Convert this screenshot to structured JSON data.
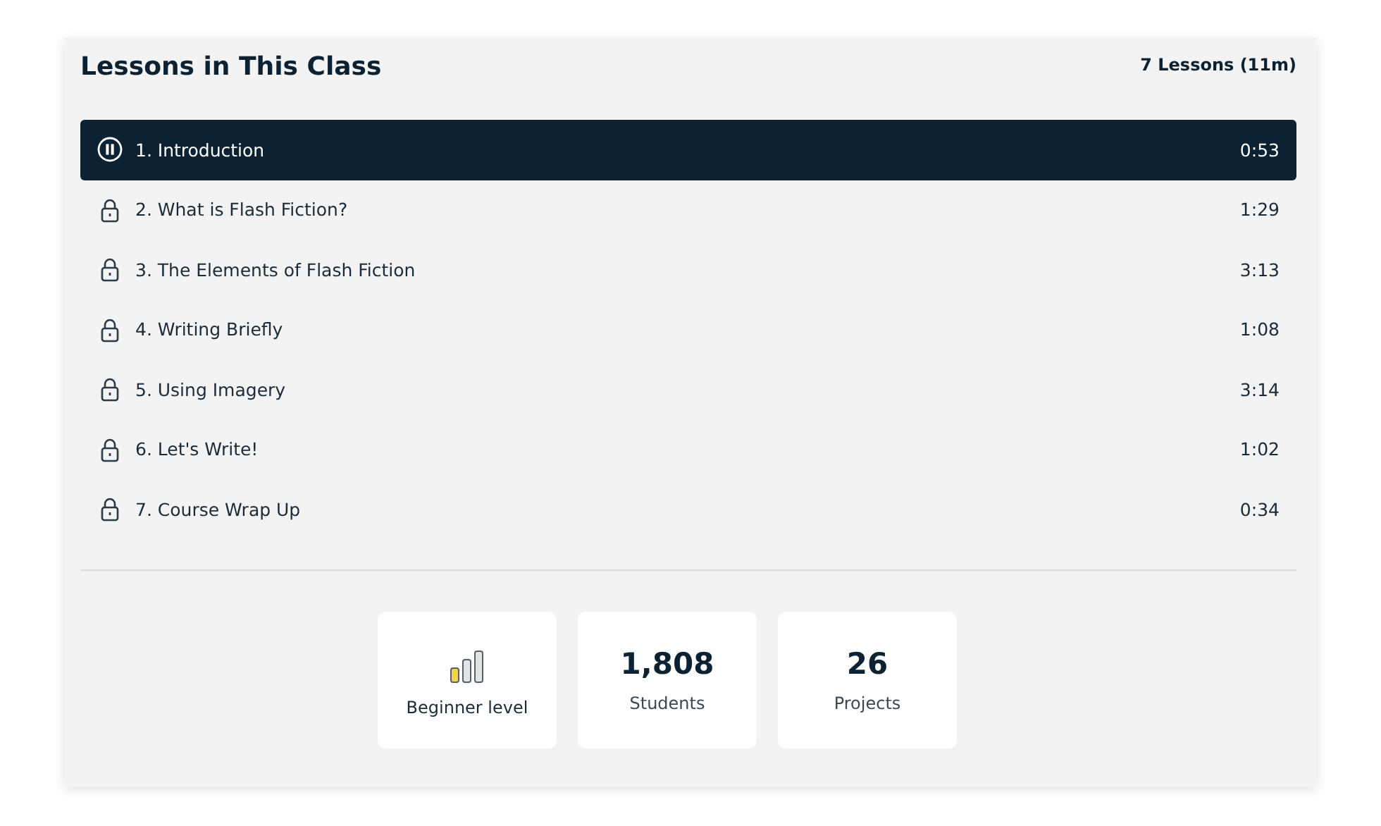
{
  "header": {
    "title": "Lessons in This Class",
    "summary": "7 Lessons (11m)"
  },
  "lessons": [
    {
      "title": "1. Introduction",
      "duration": "0:53",
      "selected": true,
      "locked": false
    },
    {
      "title": "2. What is Flash Fiction?",
      "duration": "1:29",
      "selected": false,
      "locked": true
    },
    {
      "title": "3. The Elements of Flash Fiction",
      "duration": "3:13",
      "selected": false,
      "locked": true
    },
    {
      "title": "4. Writing Briefly",
      "duration": "1:08",
      "selected": false,
      "locked": true
    },
    {
      "title": "5. Using Imagery",
      "duration": "3:14",
      "selected": false,
      "locked": true
    },
    {
      "title": "6. Let's Write!",
      "duration": "1:02",
      "selected": false,
      "locked": true
    },
    {
      "title": "7. Course Wrap Up",
      "duration": "0:34",
      "selected": false,
      "locked": true
    }
  ],
  "stats": [
    {
      "kind": "level",
      "label": "Beginner level",
      "level": 0.33
    },
    {
      "kind": "number",
      "value": "1,808",
      "label": "Students"
    },
    {
      "kind": "number",
      "value": "26",
      "label": "Projects"
    }
  ]
}
